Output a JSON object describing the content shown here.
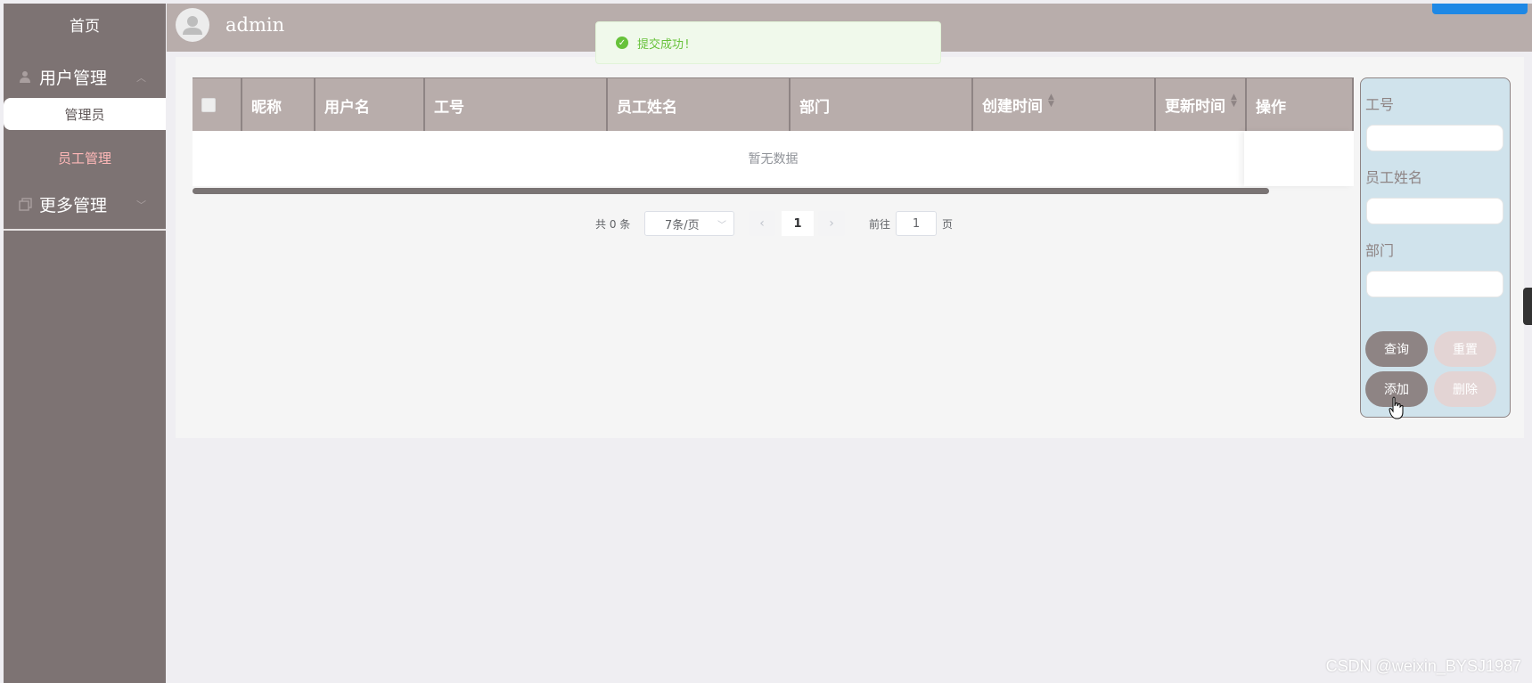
{
  "sidebar": {
    "home": "首页",
    "groups": [
      {
        "label": "用户管理",
        "icon": "user-icon",
        "items": [
          "管理员",
          "员工管理"
        ]
      },
      {
        "label": "更多管理",
        "icon": "copy-icon"
      }
    ]
  },
  "header": {
    "username": "admin"
  },
  "toast": {
    "message": "提交成功!",
    "color": "#67c23a"
  },
  "table": {
    "columns": [
      "昵称",
      "用户名",
      "工号",
      "员工姓名",
      "部门",
      "创建时间",
      "更新时间",
      "操作"
    ],
    "empty_text": "暂无数据"
  },
  "pagination": {
    "total": "共 0 条",
    "page_size": "7条/页",
    "current_page": "1",
    "goto_label": "前往",
    "goto_value": "1",
    "page_suffix": "页"
  },
  "search_panel": {
    "fields": [
      "工号",
      "员工姓名",
      "部门"
    ],
    "buttons": {
      "query": "查询",
      "reset": "重置",
      "add": "添加",
      "delete": "删除"
    }
  },
  "watermark": "CSDN @weixin_BYSJ1987",
  "colors": {
    "sidebar": "#7d7373",
    "header": "#b8adab",
    "accent_pink": "#ffb8b8",
    "panel": "#d0e3ec"
  }
}
